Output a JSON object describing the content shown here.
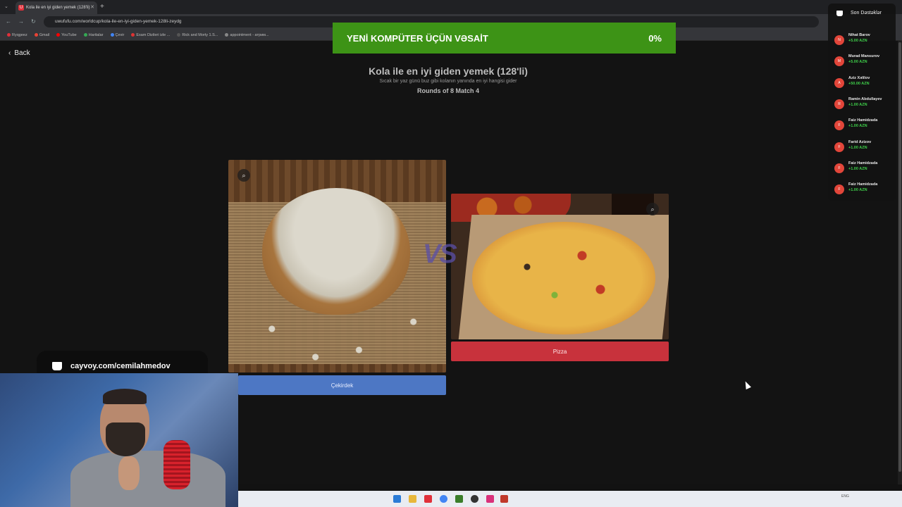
{
  "browser": {
    "tab_title": "Kola ile en iyi giden yemek (128'li)",
    "tab_favicon": "U",
    "url": "uwufufu.com/worldcup/kola-ile-en-iyi-giden-yemek-128li-zeydg",
    "bookmarks": [
      {
        "label": "Ryqgeez",
        "color": "#e0303a"
      },
      {
        "label": "Gmail",
        "color": "#ea4335"
      },
      {
        "label": "YouTube",
        "color": "#ff0000"
      },
      {
        "label": "Haritalar",
        "color": "#34a853"
      },
      {
        "label": "Çevir",
        "color": "#4285f4"
      },
      {
        "label": "Esam Dizileri izle ...",
        "color": "#d33"
      },
      {
        "label": "Rick and Morty 1.S...",
        "color": "#555"
      },
      {
        "label": "appointment - атрим...",
        "color": "#888"
      }
    ]
  },
  "page": {
    "back_label": "Back",
    "title": "Kola ile en iyi giden yemek (128'li)",
    "subtitle": "Sıcak bir yaz günü buz gibi kolanın yanında en iyi hangisi gider",
    "rounds": "Rounds of 8 Match 4",
    "vs_text": "VS",
    "left_choice": "Çekirdek",
    "right_choice": "Pizza"
  },
  "banner": {
    "text": "YENİ KOMPÜTER ÜÇÜN VƏSAİT",
    "percent": "0%",
    "progress": 0,
    "color": "#3d9316"
  },
  "donate_overlay": {
    "text": "cayvoy.com/cemilahmedov"
  },
  "supporters": {
    "title": "Son Dəstəklər",
    "items": [
      {
        "initial": "N",
        "name": "Nihat Barov",
        "amount": "+5.00 AZN"
      },
      {
        "initial": "M",
        "name": "Murad Mansurov",
        "amount": "+5.00 AZN"
      },
      {
        "initial": "A",
        "name": "Aziz Xəlilov",
        "amount": "+50.00 AZN"
      },
      {
        "initial": "R",
        "name": "Ramin Abdullayev",
        "amount": "+1.00 AZN"
      },
      {
        "initial": "F",
        "name": "Faiz Hamidzada",
        "amount": "+1.00 AZN"
      },
      {
        "initial": "F",
        "name": "Farid Azizov",
        "amount": "+1.00 AZN"
      },
      {
        "initial": "F",
        "name": "Faiz Hamidzada",
        "amount": "+1.00 AZN"
      },
      {
        "initial": "F",
        "name": "Faiz Hamidzada",
        "amount": "+1.00 AZN"
      }
    ]
  },
  "taskbar": {
    "language": "ENG"
  },
  "colors": {
    "left_button": "#4d77c4",
    "right_button": "#c8323c",
    "background": "#131313"
  }
}
